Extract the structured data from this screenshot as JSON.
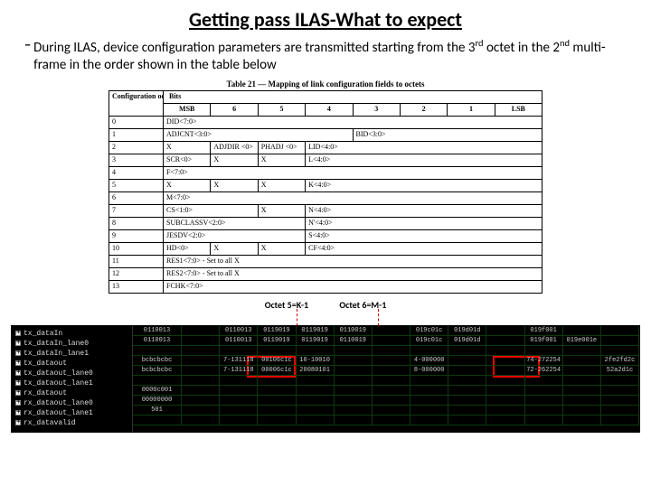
{
  "title": "Getting pass ILAS-What to expect",
  "bullet": "During ILAS, device configuration parameters are transmitted starting from the 3rd octet in the 2nd multi-frame in the order shown in the table below",
  "table_caption": "Table 21 — Mapping of link configuration fields to octets",
  "cfg_header_label": "Configuration octet no.",
  "bits_header": "Bits",
  "bit_cols": [
    "MSB",
    "6",
    "5",
    "4",
    "3",
    "2",
    "1",
    "LSB"
  ],
  "rows": [
    {
      "idx": "0",
      "cells": [
        [
          "DID<7:0>",
          8
        ]
      ]
    },
    {
      "idx": "1",
      "cells": [
        [
          "ADJCNT<3:0>",
          4
        ],
        [
          "BID<3:0>",
          4
        ]
      ]
    },
    {
      "idx": "2",
      "cells": [
        [
          "X",
          1
        ],
        [
          "ADJDIR <0>",
          1
        ],
        [
          "PHADJ <0>",
          1
        ],
        [
          "LID<4:0>",
          5
        ]
      ]
    },
    {
      "idx": "3",
      "cells": [
        [
          "SCR<0>",
          1
        ],
        [
          "X",
          1
        ],
        [
          "X",
          1
        ],
        [
          "L<4:0>",
          5
        ]
      ]
    },
    {
      "idx": "4",
      "cells": [
        [
          "F<7:0>",
          8
        ]
      ]
    },
    {
      "idx": "5",
      "cells": [
        [
          "X",
          1
        ],
        [
          "X",
          1
        ],
        [
          "X",
          1
        ],
        [
          "K<4:0>",
          5
        ]
      ]
    },
    {
      "idx": "6",
      "cells": [
        [
          "M<7:0>",
          8
        ]
      ]
    },
    {
      "idx": "7",
      "cells": [
        [
          "CS<1:0>",
          2
        ],
        [
          "X",
          1
        ],
        [
          "N<4:0>",
          5
        ]
      ]
    },
    {
      "idx": "8",
      "cells": [
        [
          "SUBCLASSV<2:0>",
          3
        ],
        [
          "N'<4:0>",
          5
        ]
      ]
    },
    {
      "idx": "9",
      "cells": [
        [
          "JESDV<2:0>",
          3
        ],
        [
          "S<4:0>",
          5
        ]
      ]
    },
    {
      "idx": "10",
      "cells": [
        [
          "HD<0>",
          1
        ],
        [
          "X",
          1
        ],
        [
          "X",
          1
        ],
        [
          "CF<4:0>",
          5
        ]
      ]
    },
    {
      "idx": "11",
      "cells": [
        [
          "RES1<7:0> - Set to all X",
          8
        ]
      ]
    },
    {
      "idx": "12",
      "cells": [
        [
          "RES2<7:0> - Set to all X",
          8
        ]
      ]
    },
    {
      "idx": "13",
      "cells": [
        [
          "FCHK<7:0>",
          8
        ]
      ]
    }
  ],
  "annotations": {
    "left": "Octet 5=K-1",
    "right": "Octet 6=M-1"
  },
  "wave_signals": [
    "tx_dataIn",
    "tx_dataIn_lane0",
    "tx_dataIn_lane1",
    "tx_dataout",
    "tx_dataout_lane0",
    "tx_dataout_lane1",
    "rx_dataout",
    "rx_dataout_lane0",
    "rx_dataout_lane1",
    "rx_datavalid"
  ],
  "wave_values": {
    "r0": [
      "0110013",
      "",
      "0110013",
      "0119019",
      "0119019",
      "0110019",
      "",
      "019c01c",
      "019d01d",
      "",
      "019f001",
      "",
      ""
    ],
    "r1": [
      "0110013",
      "",
      "0110013",
      "0119019",
      "0119019",
      "0110019",
      "",
      "019c01c",
      "019d01d",
      "",
      "019f001",
      "019e001e",
      ""
    ],
    "r2": [
      "",
      "",
      "",
      "",
      "",
      "",
      "",
      "",
      "",
      "",
      "",
      "",
      ""
    ],
    "r3": [
      "bcbcbcbc",
      "",
      "7-131118",
      "00106c1c",
      "10-10010",
      "",
      "",
      "4-000000",
      "",
      "",
      "74-272254",
      "",
      "2fe2fd2c"
    ],
    "r4": [
      "bcbcbcbc",
      "",
      "7-131118",
      "00006c1c",
      "20080101",
      "",
      "",
      "8-000000",
      "",
      "",
      "72-262254",
      "",
      "52a2d1c"
    ],
    "r5": [
      "",
      "",
      "",
      "",
      "",
      "",
      "",
      "",
      "",
      "",
      "",
      "",
      ""
    ],
    "r6": [
      "0000c001",
      "",
      "",
      "",
      "",
      "",
      "",
      "",
      "",
      "",
      "",
      "",
      ""
    ],
    "r7": [
      "00000000",
      "",
      "",
      "",
      "",
      "",
      "",
      "",
      "",
      "",
      "",
      "",
      ""
    ],
    "r8": [
      "501",
      "",
      "",
      "",
      "",
      "",
      "",
      "",
      "",
      "",
      "",
      "",
      ""
    ],
    "r9": [
      "",
      "",
      "",
      "",
      "",
      "",
      "",
      "",
      "",
      "",
      "",
      "",
      ""
    ]
  }
}
